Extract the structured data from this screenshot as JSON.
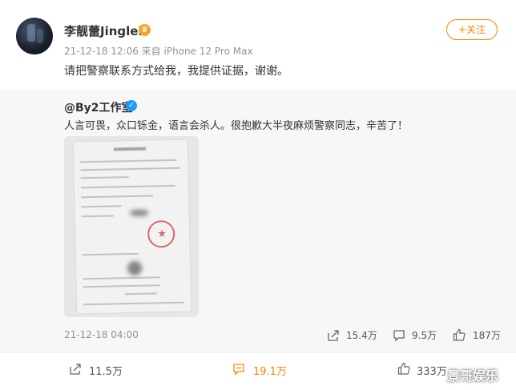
{
  "post": {
    "username": "李靓蕾Jinglei",
    "verify_badge": "♛",
    "meta": "21-12-18 12:06  来自 iPhone 12 Pro Max",
    "follow_label": "+关注",
    "text": "请把警察联系方式给我，我提供证据，谢谢。"
  },
  "repost": {
    "author": "@By2工作室",
    "blue_v": "✓",
    "text": "人言可畏，众口铄金，语言会杀人。很抱歉大半夜麻烦警察同志，辛苦了！",
    "image_icon": "police-report-photo",
    "time": "21-12-18 04:00",
    "stats": {
      "repost_count": "15.4万",
      "comment_count": "9.5万",
      "like_count": "187万"
    }
  },
  "actions": {
    "repost_count": "11.5万",
    "comment_count": "19.1万",
    "like_count": "333万"
  },
  "watermark": "景哥娱乐",
  "colors": {
    "accent": "#ff8200",
    "verify_blue": "#1f9bff",
    "meta_gray": "#939393",
    "repost_bg": "#f7f7f7"
  }
}
